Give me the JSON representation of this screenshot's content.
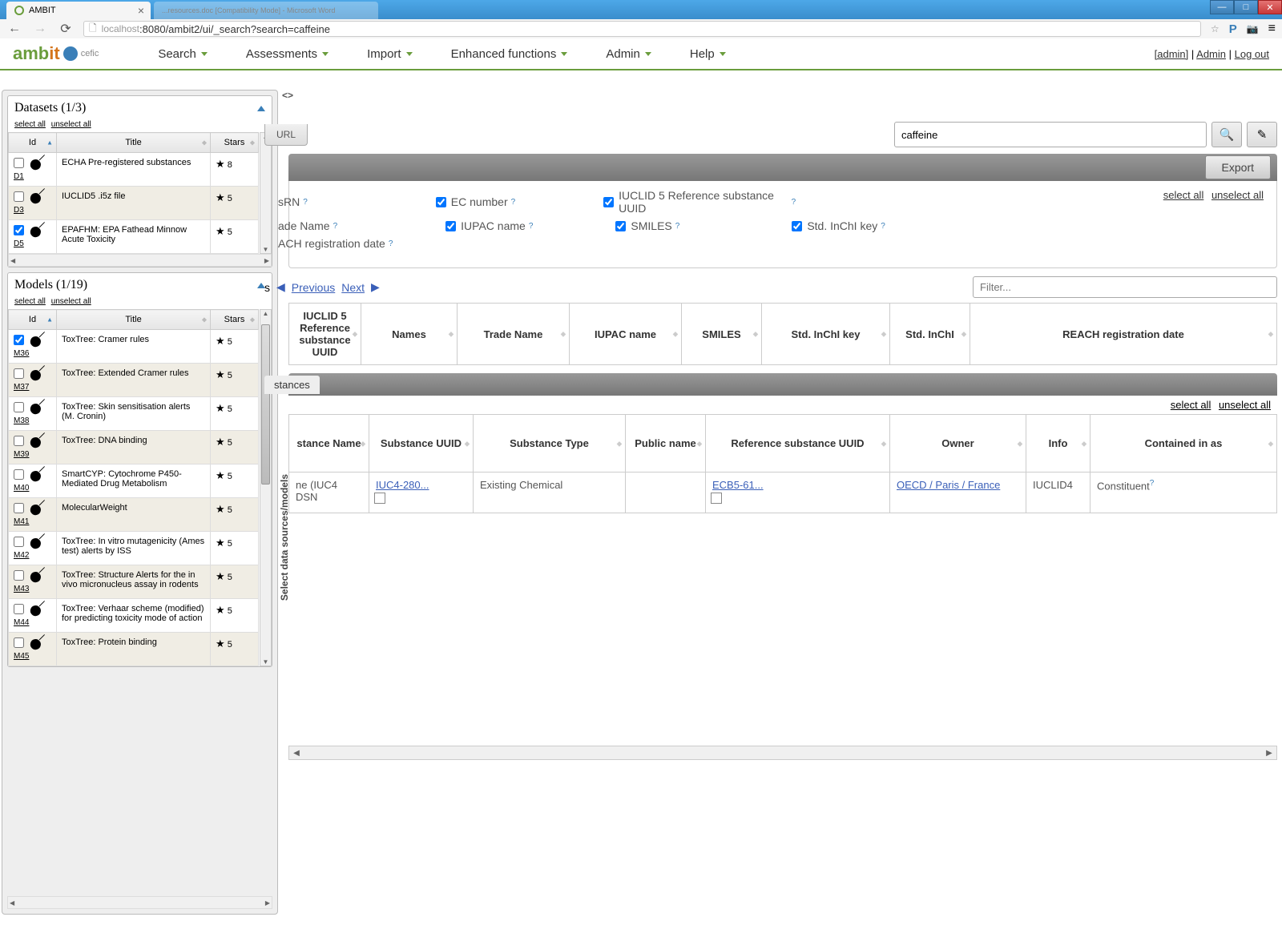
{
  "browser": {
    "tab_title": "AMBIT",
    "ghost_tab": "...resources.doc [Compatibility Mode] - Microsoft Word",
    "url_host": "localhost",
    "url_path": ":8080/ambit2/ui/_search?search=caffeine"
  },
  "header": {
    "logo_p1": "amb",
    "logo_p2": "it",
    "cefic": "cefic",
    "nav": [
      "Search",
      "Assessments",
      "Import",
      "Enhanced functions",
      "Admin",
      "Help"
    ],
    "admin_link": "[admin]",
    "admin2": "Admin",
    "logout": "Log out"
  },
  "sidebar": {
    "datasets_title": "Datasets (1/3)",
    "models_title": "Models (1/19)",
    "select_all": "select all",
    "unselect_all": "unselect all",
    "cols": {
      "id": "Id",
      "title": "Title",
      "stars": "Stars"
    },
    "datasets": [
      {
        "id": "D1",
        "title": "ECHA Pre-registered substances",
        "stars": "8",
        "checked": false
      },
      {
        "id": "D3",
        "title": "IUCLID5 .i5z file",
        "stars": "5",
        "checked": false
      },
      {
        "id": "D5",
        "title": "EPAFHM: EPA Fathead Minnow Acute Toxicity",
        "stars": "5",
        "checked": true
      }
    ],
    "models": [
      {
        "id": "M36",
        "title": "ToxTree: Cramer rules",
        "stars": "5",
        "checked": true
      },
      {
        "id": "M37",
        "title": "ToxTree: Extended Cramer rules",
        "stars": "5",
        "checked": false
      },
      {
        "id": "M38",
        "title": "ToxTree: Skin sensitisation alerts (M. Cronin)",
        "stars": "5",
        "checked": false
      },
      {
        "id": "M39",
        "title": "ToxTree: DNA binding",
        "stars": "5",
        "checked": false
      },
      {
        "id": "M40",
        "title": "SmartCYP: Cytochrome P450-Mediated Drug Metabolism",
        "stars": "5",
        "checked": false
      },
      {
        "id": "M41",
        "title": "MolecularWeight",
        "stars": "5",
        "checked": false
      },
      {
        "id": "M42",
        "title": "ToxTree: In vitro mutagenicity (Ames test) alerts by ISS",
        "stars": "5",
        "checked": false
      },
      {
        "id": "M43",
        "title": "ToxTree: Structure Alerts for the in vivo micronucleus assay in rodents",
        "stars": "5",
        "checked": false
      },
      {
        "id": "M44",
        "title": "ToxTree: Verhaar scheme (modified) for predicting toxicity mode of action",
        "stars": "5",
        "checked": false
      },
      {
        "id": "M45",
        "title": "ToxTree: Protein binding",
        "stars": "5",
        "checked": false
      }
    ]
  },
  "main": {
    "url_btn": "URL",
    "search_value": "caffeine",
    "export": "Export",
    "select_all": "select all",
    "unselect_all": "unselect all",
    "vert_label": "Select data sources/models",
    "filters": {
      "casrn": "sRN",
      "ec": "EC number",
      "iuclid_ref": "IUCLID 5 Reference substance UUID",
      "trade": "ade Name",
      "iupac": "IUPAC name",
      "smiles": "SMILES",
      "inchikey": "Std. InChI key",
      "reach": "ACH registration date"
    },
    "pager": {
      "showing": "s",
      "prev": "Previous",
      "next": "Next"
    },
    "filter_placeholder": "Filter...",
    "columns": [
      "IUCLID 5 Reference substance UUID",
      "Names",
      "Trade Name",
      "IUPAC name",
      "SMILES",
      "Std. InChI key",
      "Std. InChI",
      "REACH registration date"
    ],
    "substances_tab": "stances",
    "sub_columns": [
      "stance Name",
      "Substance UUID",
      "Substance Type",
      "Public name",
      "Reference substance UUID",
      "Owner",
      "Info",
      "Contained in as"
    ],
    "sub_row": {
      "name": "ne (IUC4 DSN",
      "uuid": "IUC4-280...",
      "type": "Existing Chemical",
      "public": "",
      "ref_uuid": "ECB5-61...",
      "owner": "OECD / Paris / France",
      "info": "IUCLID4",
      "contained": "Constituent"
    }
  }
}
